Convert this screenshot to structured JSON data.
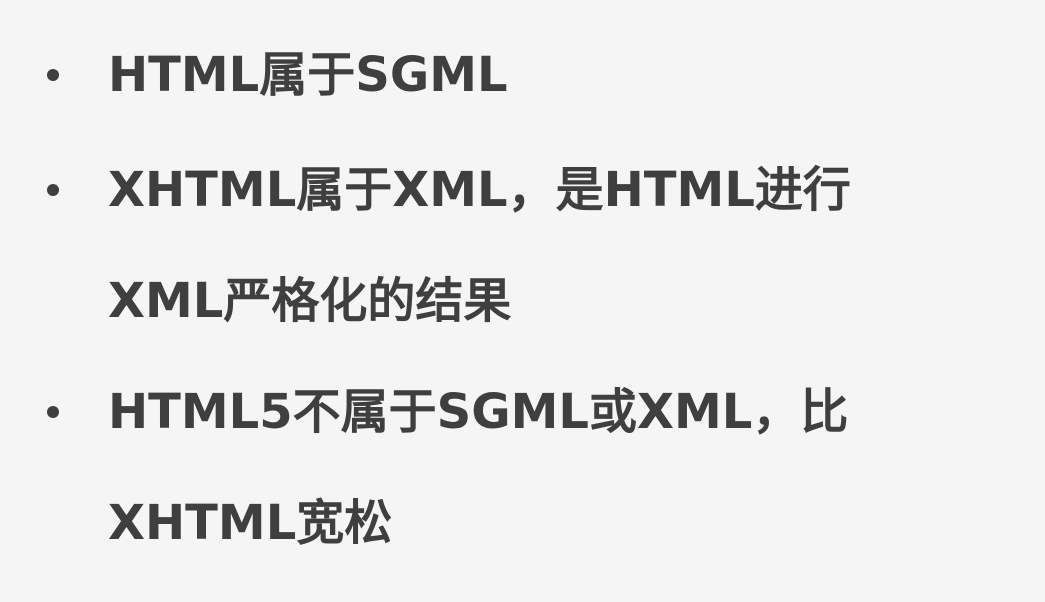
{
  "slide": {
    "bullets": [
      {
        "lines": [
          "HTML属于SGML"
        ]
      },
      {
        "lines": [
          "XHTML属于XML，是HTML进行",
          "XML严格化的结果"
        ]
      },
      {
        "lines": [
          "HTML5不属于SGML或XML，比",
          "XHTML宽松"
        ]
      }
    ]
  }
}
